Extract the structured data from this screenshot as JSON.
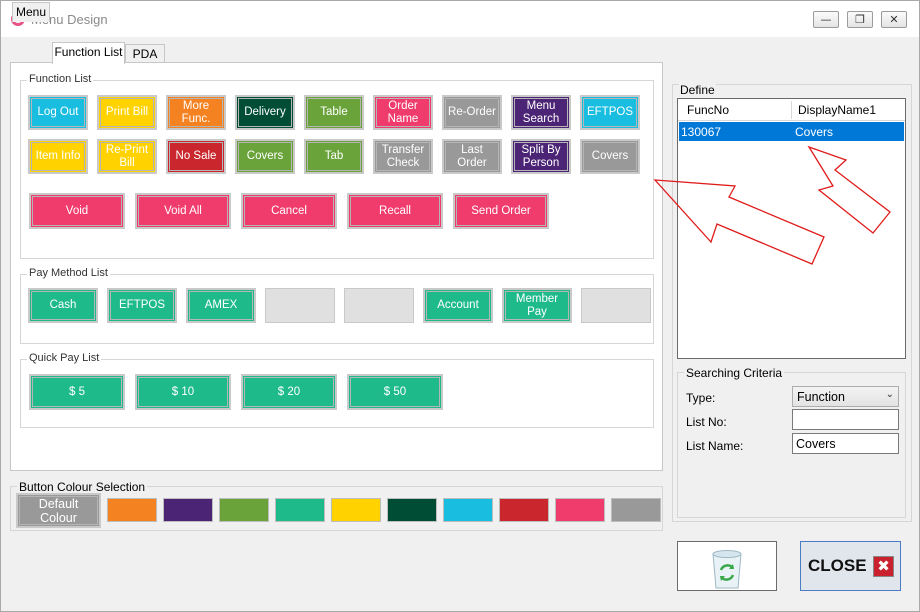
{
  "window": {
    "title": "Menu Design"
  },
  "tabs": [
    "Menu",
    "Function List",
    "PDA"
  ],
  "function_list": {
    "label": "Function List",
    "buttons": [
      {
        "label": "Log Out",
        "color": "#19bde0"
      },
      {
        "label": "Print Bill",
        "color": "#ffd200"
      },
      {
        "label": "More Func.",
        "color": "#f58220"
      },
      {
        "label": "Delivery",
        "color": "#004d36"
      },
      {
        "label": "Table",
        "color": "#6aa33a"
      },
      {
        "label": "Order Name",
        "color": "#ef3c6d"
      },
      {
        "label": "Re-Order",
        "color": "#999999"
      },
      {
        "label": "Menu Search",
        "color": "#4b2475"
      },
      {
        "label": "EFTPOS",
        "color": "#19bde0"
      },
      {
        "label": "Item Info",
        "color": "#ffd200"
      },
      {
        "label": "Re-Print Bill",
        "color": "#ffd200"
      },
      {
        "label": "No Sale",
        "color": "#c9272d"
      },
      {
        "label": "Covers",
        "color": "#6aa33a"
      },
      {
        "label": "Tab",
        "color": "#6aa33a"
      },
      {
        "label": "Transfer Check",
        "color": "#999999"
      },
      {
        "label": "Last Order",
        "color": "#999999"
      },
      {
        "label": "Split By Person",
        "color": "#4b2475"
      },
      {
        "label": "Covers",
        "color": "#999999"
      }
    ],
    "large_buttons": [
      {
        "label": "Void",
        "color": "#ef3c6d"
      },
      {
        "label": "Void All",
        "color": "#ef3c6d"
      },
      {
        "label": "Cancel",
        "color": "#ef3c6d"
      },
      {
        "label": "Recall",
        "color": "#ef3c6d"
      },
      {
        "label": "Send Order",
        "color": "#ef3c6d"
      }
    ]
  },
  "pay_method_list": {
    "label": "Pay Method List",
    "buttons": [
      {
        "label": "Cash",
        "color": "#1fba8a"
      },
      {
        "label": "EFTPOS",
        "color": "#1fba8a"
      },
      {
        "label": "AMEX",
        "color": "#1fba8a"
      },
      {
        "label": "",
        "color": "#e0e0e0"
      },
      {
        "label": "",
        "color": "#e0e0e0"
      },
      {
        "label": "Account",
        "color": "#1fba8a"
      },
      {
        "label": "Member Pay",
        "color": "#1fba8a"
      },
      {
        "label": "",
        "color": "#e0e0e0"
      }
    ]
  },
  "quick_pay_list": {
    "label": "Quick Pay List",
    "buttons": [
      {
        "label": "$ 5",
        "color": "#1fba8a"
      },
      {
        "label": "$ 10",
        "color": "#1fba8a"
      },
      {
        "label": "$ 20",
        "color": "#1fba8a"
      },
      {
        "label": "$ 50",
        "color": "#1fba8a"
      }
    ]
  },
  "button_colour_selection": {
    "label": "Button Colour Selection",
    "default_label": "Default Colour",
    "default_color": "#999999",
    "swatches": [
      "#f58220",
      "#4b2475",
      "#6aa33a",
      "#1fba8a",
      "#ffd200",
      "#004d36",
      "#19bde0",
      "#c9272d",
      "#ef3c6d",
      "#999999"
    ]
  },
  "define": {
    "label": "Define",
    "columns": [
      "FuncNo",
      "DisplayName1"
    ],
    "rows": [
      {
        "func_no": "130067",
        "display_name": "Covers"
      }
    ]
  },
  "searching_criteria": {
    "label": "Searching Criteria",
    "type_label": "Type:",
    "type_value": "Function",
    "list_no_label": "List No:",
    "list_no_value": "",
    "list_name_label": "List Name:",
    "list_name_value": "Covers"
  },
  "actions": {
    "close_label": "CLOSE"
  },
  "icons": {
    "recycle": "recycle-bin-icon",
    "close": "close-x-icon"
  },
  "accent_color": "#0078d7"
}
